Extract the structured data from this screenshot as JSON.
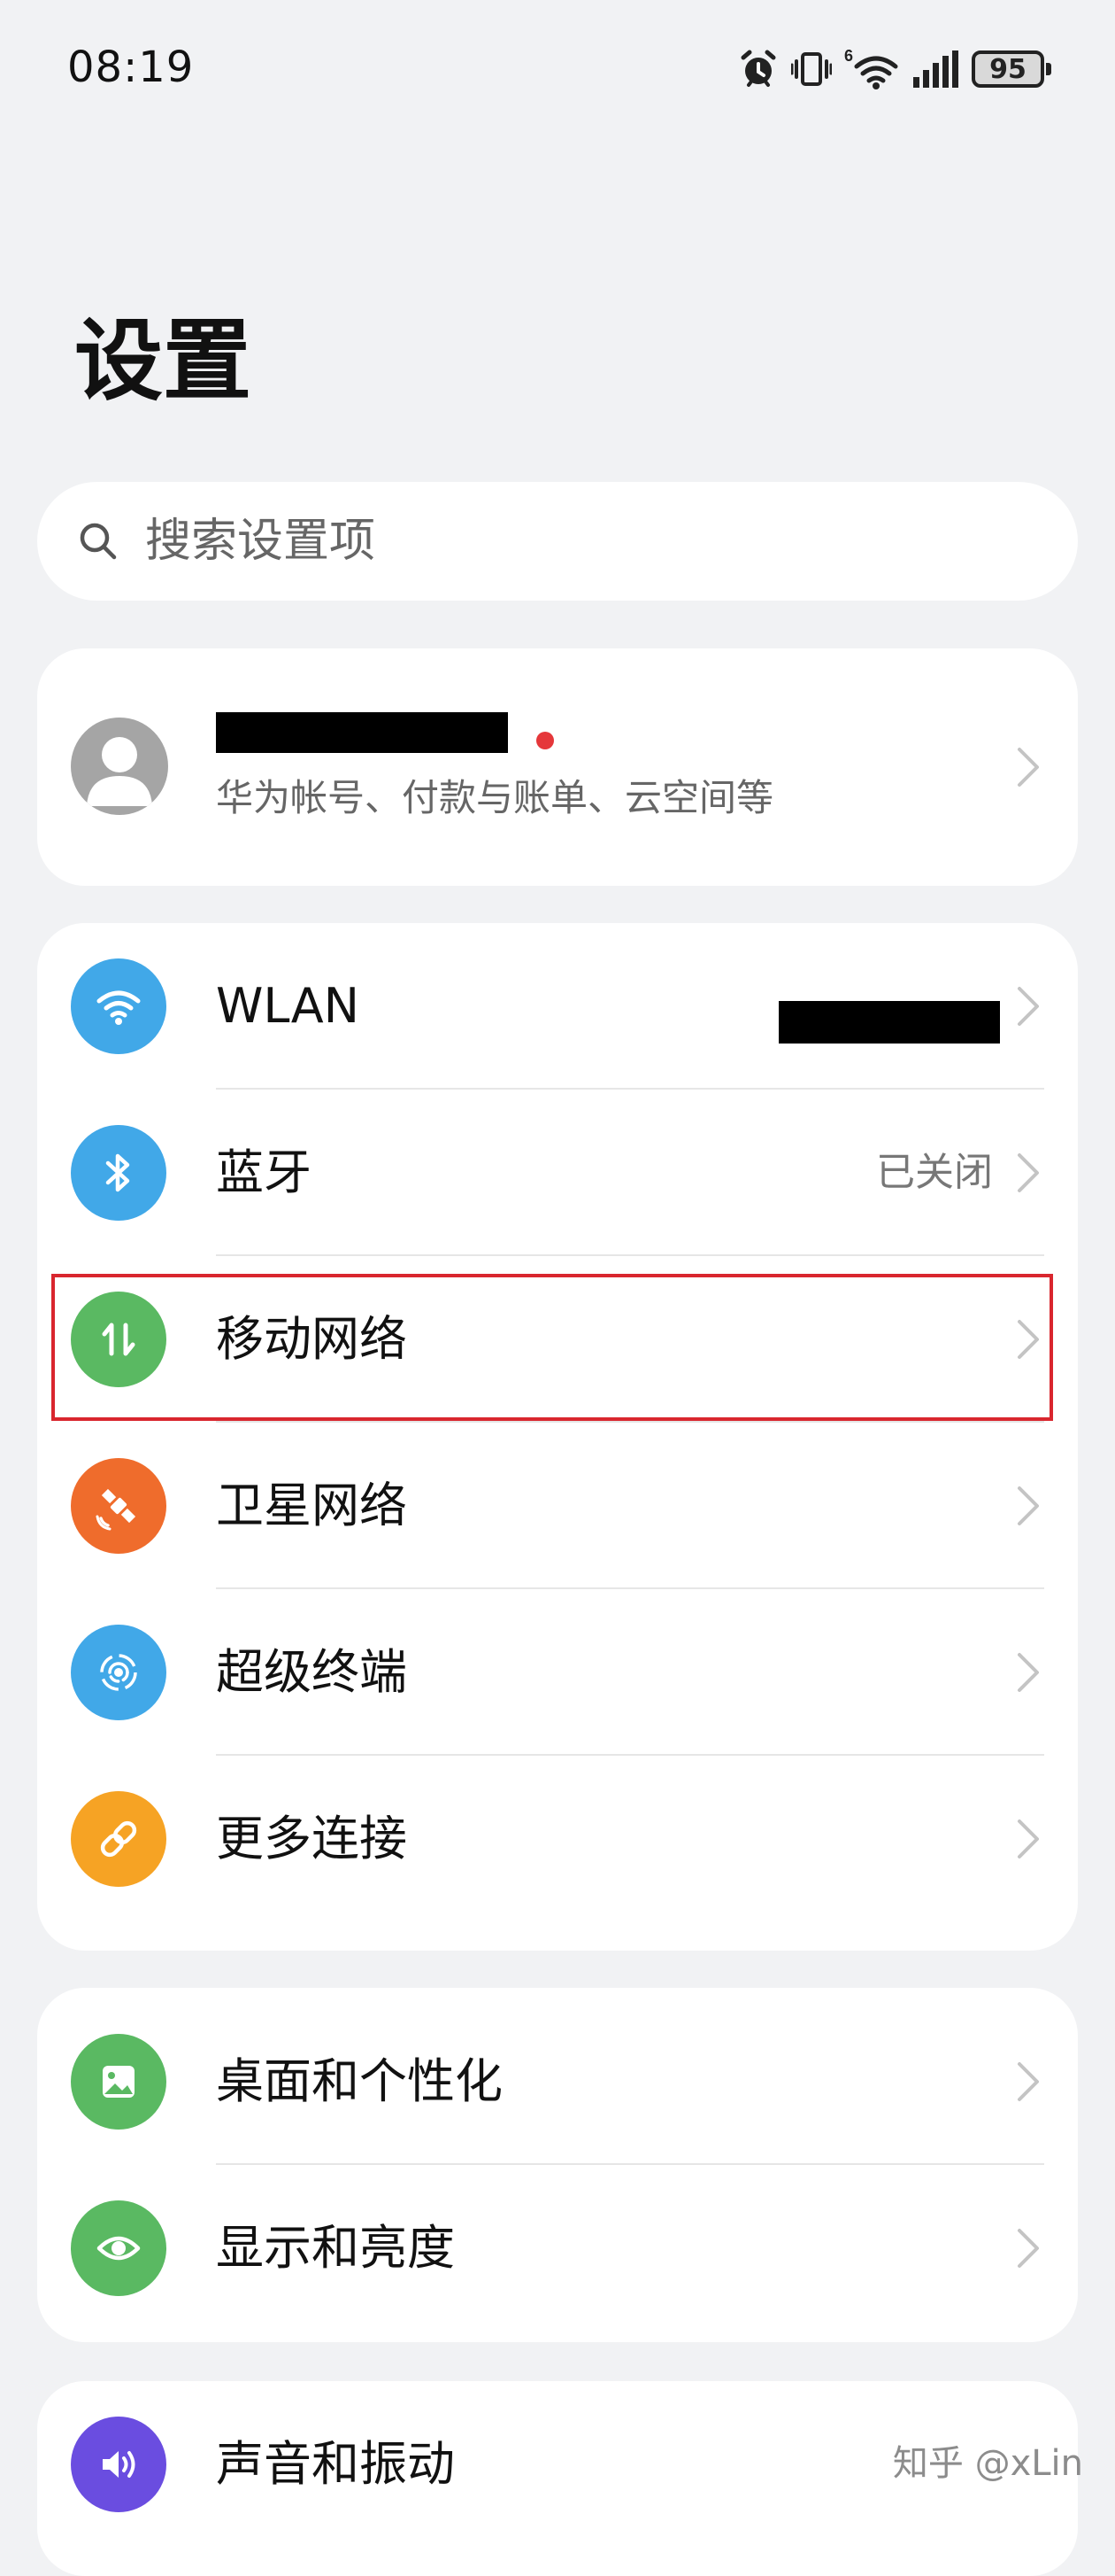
{
  "status_bar": {
    "time": "08:19",
    "battery": "95",
    "network_generation": "6",
    "icons": [
      "alarm-icon",
      "vibrate-icon",
      "wifi-icon",
      "signal-icon",
      "battery-icon"
    ]
  },
  "page": {
    "title": "设置"
  },
  "search": {
    "placeholder": "搜索设置项",
    "icon": "search-icon"
  },
  "account": {
    "subtitle": "华为帐号、付款与账单、云空间等",
    "notification_dot_color": "#e5373a",
    "avatar_icon": "person-icon"
  },
  "connectivity": {
    "items": [
      {
        "label": "WLAN",
        "value": "",
        "icon": "wifi-icon",
        "icon_color": "#41a8e8"
      },
      {
        "label": "蓝牙",
        "value": "已关闭",
        "icon": "bluetooth-icon",
        "icon_color": "#41a8e8"
      },
      {
        "label": "移动网络",
        "value": "",
        "icon": "mobile-data-icon",
        "icon_color": "#5ab962",
        "highlighted": true
      },
      {
        "label": "卫星网络",
        "value": "",
        "icon": "satellite-icon",
        "icon_color": "#ef6c2c"
      },
      {
        "label": "超级终端",
        "value": "",
        "icon": "super-device-icon",
        "icon_color": "#41a8e8"
      },
      {
        "label": "更多连接",
        "value": "",
        "icon": "link-icon",
        "icon_color": "#f6a324"
      }
    ]
  },
  "personalization": {
    "items": [
      {
        "label": "桌面和个性化",
        "icon": "wallpaper-icon",
        "icon_color": "#5ab962"
      },
      {
        "label": "显示和亮度",
        "icon": "eye-icon",
        "icon_color": "#5ab962"
      }
    ]
  },
  "sound": {
    "items": [
      {
        "label": "声音和振动",
        "icon": "speaker-icon",
        "icon_color": "#6a4de0"
      }
    ]
  },
  "highlight_color": "#d9262e",
  "watermark": "知乎 @xLin"
}
